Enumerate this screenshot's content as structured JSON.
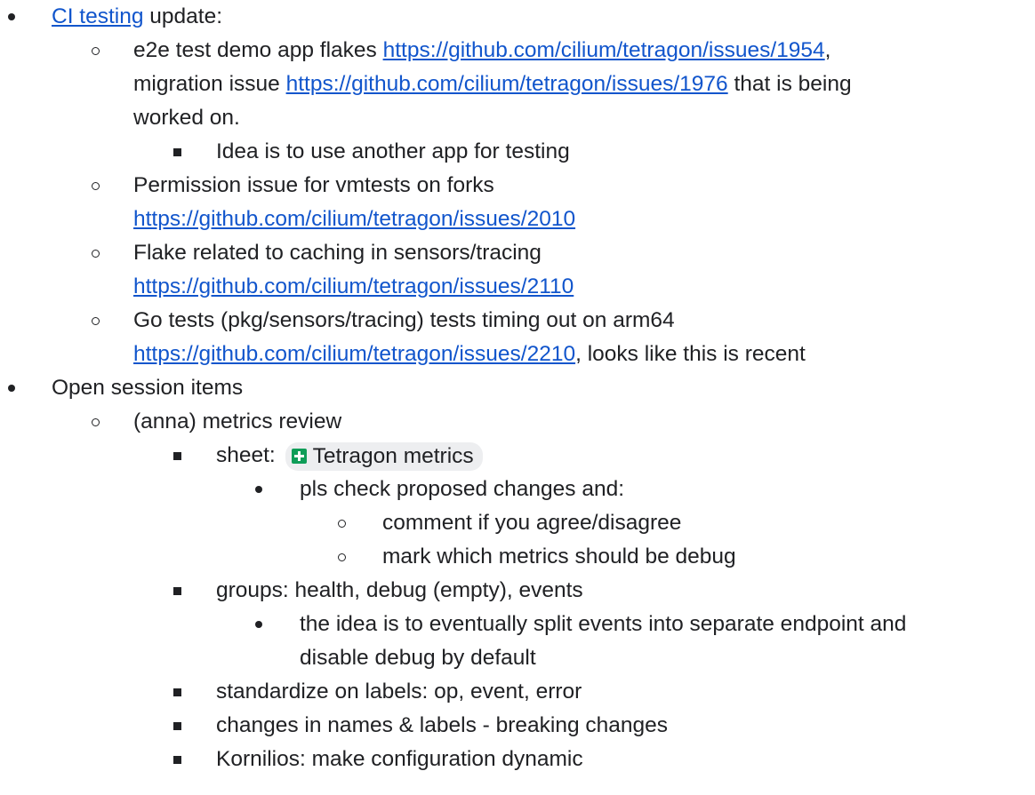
{
  "items": {
    "ci": {
      "link": "CI testing",
      "rest": " update:"
    },
    "e2e": {
      "t1": "e2e test demo app flakes ",
      "link1": "https://github.com/cilium/tetragon/issues/1954",
      "t2": ",",
      "t3": "migration issue ",
      "link2": "https://github.com/cilium/tetragon/issues/1976",
      "t4": " that is being",
      "t5": "worked on."
    },
    "idea": "Idea is to use another app for testing",
    "perm": {
      "text": "Permission issue for vmtests on forks",
      "link": "https://github.com/cilium/tetragon/issues/2010"
    },
    "flake": {
      "text": "Flake related to caching in sensors/tracing",
      "link": "https://github.com/cilium/tetragon/issues/2110"
    },
    "gotests": {
      "text": "Go tests (pkg/sensors/tracing) tests timing out on arm64",
      "link": "https://github.com/cilium/tetragon/issues/2210",
      "rest": ", looks like this is recent"
    },
    "open": "Open session items",
    "metrics": "(anna) metrics review",
    "sheet": {
      "label": "sheet: ",
      "chip": "Tetragon metrics"
    },
    "pls": "pls check proposed changes and:",
    "comment": "comment if you agree/disagree",
    "mark": "mark which metrics should be debug",
    "groups": "groups: health, debug (empty), events",
    "eventually": {
      "line1": "the idea is to eventually split events into separate endpoint and",
      "line2": "disable debug by default"
    },
    "standardize": "standardize on labels: op, event, error",
    "changes": "changes in names & labels - breaking changes",
    "kornilios": "Kornilios: make configuration dynamic"
  },
  "icons": {
    "sheet_chip_icon": "google-sheets-icon"
  },
  "colors": {
    "text": "#202124",
    "link": "#1155cc",
    "chip_bg": "#edeef0",
    "sheets_green": "#0f9d58"
  }
}
